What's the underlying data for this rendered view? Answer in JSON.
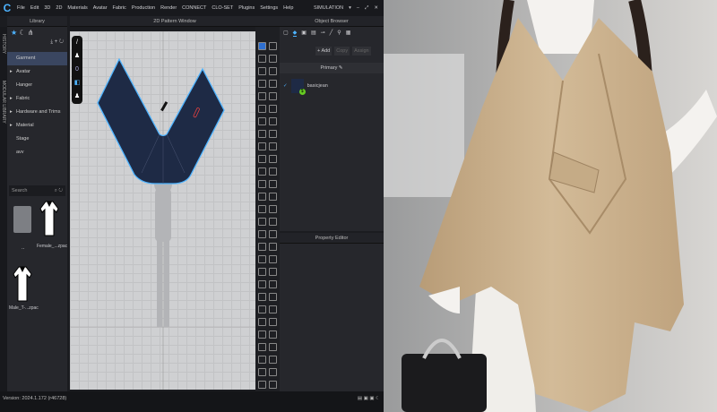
{
  "app": {
    "logo": "C",
    "menu": [
      "File",
      "Edit",
      "3D",
      "2D",
      "Materials",
      "Avatar",
      "Fabric",
      "Production",
      "Render",
      "CONNECT",
      "CLO-SET",
      "Plugins",
      "Settings",
      "Help"
    ],
    "mode": "SIMULATION"
  },
  "side_tabs": [
    "HISTORY",
    "MODULAR LIBRARY"
  ],
  "library": {
    "title": "Library",
    "items": [
      {
        "label": "Garment",
        "selected": true,
        "expandable": false
      },
      {
        "label": "Avatar",
        "expandable": true
      },
      {
        "label": "Hanger",
        "expandable": false
      },
      {
        "label": "Fabric",
        "expandable": true
      },
      {
        "label": "Hardware and Trims",
        "expandable": true
      },
      {
        "label": "Material",
        "expandable": true
      },
      {
        "label": "Stage",
        "expandable": false
      },
      {
        "label": "avv",
        "expandable": false
      }
    ],
    "search_placeholder": "Search",
    "files": [
      {
        "name": "..",
        "type": "folder"
      },
      {
        "name": "Female_...zpac",
        "type": "garment"
      },
      {
        "name": "Male_T-...zpac",
        "type": "garment"
      }
    ]
  },
  "pattern_window": {
    "title": "2D Pattern Window",
    "pattern_color": "#1e2a45",
    "outline_color": "#4db3ff"
  },
  "object_browser": {
    "title": "Object Browser",
    "add": "Add",
    "copy": "Copy",
    "assign": "Assign",
    "colorway": "Primary",
    "fabric_item": "basicjean"
  },
  "property_editor": {
    "title": "Property Editor"
  },
  "status": {
    "version": "Version: 2024.1.172 (r46728)"
  },
  "colors": {
    "accent": "#4db3ff",
    "panel": "#26272c",
    "cape": "#c9b08c"
  }
}
